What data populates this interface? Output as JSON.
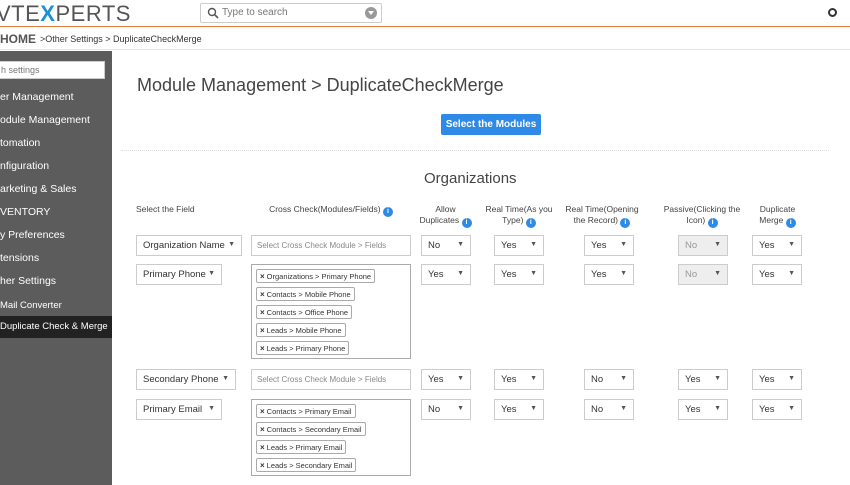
{
  "topbar": {
    "logo_left": "VTE",
    "logo_x": "X",
    "logo_right": "PERTS",
    "search_placeholder": "Type to search"
  },
  "breadcrumb": {
    "home": "HOME",
    "rest": ">Other Settings > DuplicateCheckMerge"
  },
  "sidebar": {
    "search_placeholder": "h settings",
    "items": [
      {
        "label": "er Management"
      },
      {
        "label": "odule Management"
      },
      {
        "label": "tomation"
      },
      {
        "label": "nfiguration"
      },
      {
        "label": "arketing & Sales"
      },
      {
        "label": "VENTORY"
      },
      {
        "label": "y Preferences"
      },
      {
        "label": "tensions"
      },
      {
        "label": "her Settings"
      },
      {
        "label": "Mail Converter"
      },
      {
        "label": "Duplicate Check & Merge"
      }
    ]
  },
  "main": {
    "title": "Module Management > DuplicateCheckMerge",
    "select_modules_button": "Select the Modules",
    "section_title": "Organizations",
    "columns": [
      "Select the Field",
      "Cross Check(Modules/Fields)",
      "Allow Duplicates",
      "Real Time(As you Type)",
      "Real Time(Opening the Record)",
      "Passive(Clicking the Icon)",
      "Duplicate Merge"
    ],
    "empty_cross_placeholder": "Select Cross Check Module > Fields",
    "rows": [
      {
        "field": "Organization Name",
        "tags": [],
        "allow": "No",
        "rt_type": "Yes",
        "rt_open": "Yes",
        "passive": "No",
        "merge": "Yes"
      },
      {
        "field": "Primary Phone",
        "tags": [
          "Organizations > Primary Phone",
          "Contacts > Mobile Phone",
          "Contacts > Office Phone",
          "Leads > Mobile Phone",
          "Leads > Primary Phone"
        ],
        "allow": "Yes",
        "rt_type": "Yes",
        "rt_open": "Yes",
        "passive": "No",
        "merge": "Yes"
      },
      {
        "field": "Secondary Phone",
        "tags": [],
        "allow": "Yes",
        "rt_type": "Yes",
        "rt_open": "No",
        "passive": "Yes",
        "merge": "Yes"
      },
      {
        "field": "Primary Email",
        "tags": [
          "Contacts > Primary Email",
          "Contacts > Secondary Email",
          "Leads > Primary Email",
          "Leads > Secondary Email"
        ],
        "allow": "No",
        "rt_type": "Yes",
        "rt_open": "No",
        "passive": "Yes",
        "merge": "Yes"
      }
    ]
  },
  "colors": {
    "accent": "#2e8ae6",
    "topbar_border": "#e07b39",
    "sidebar": "#5c5c5c",
    "sidebar_active": "#222222"
  }
}
